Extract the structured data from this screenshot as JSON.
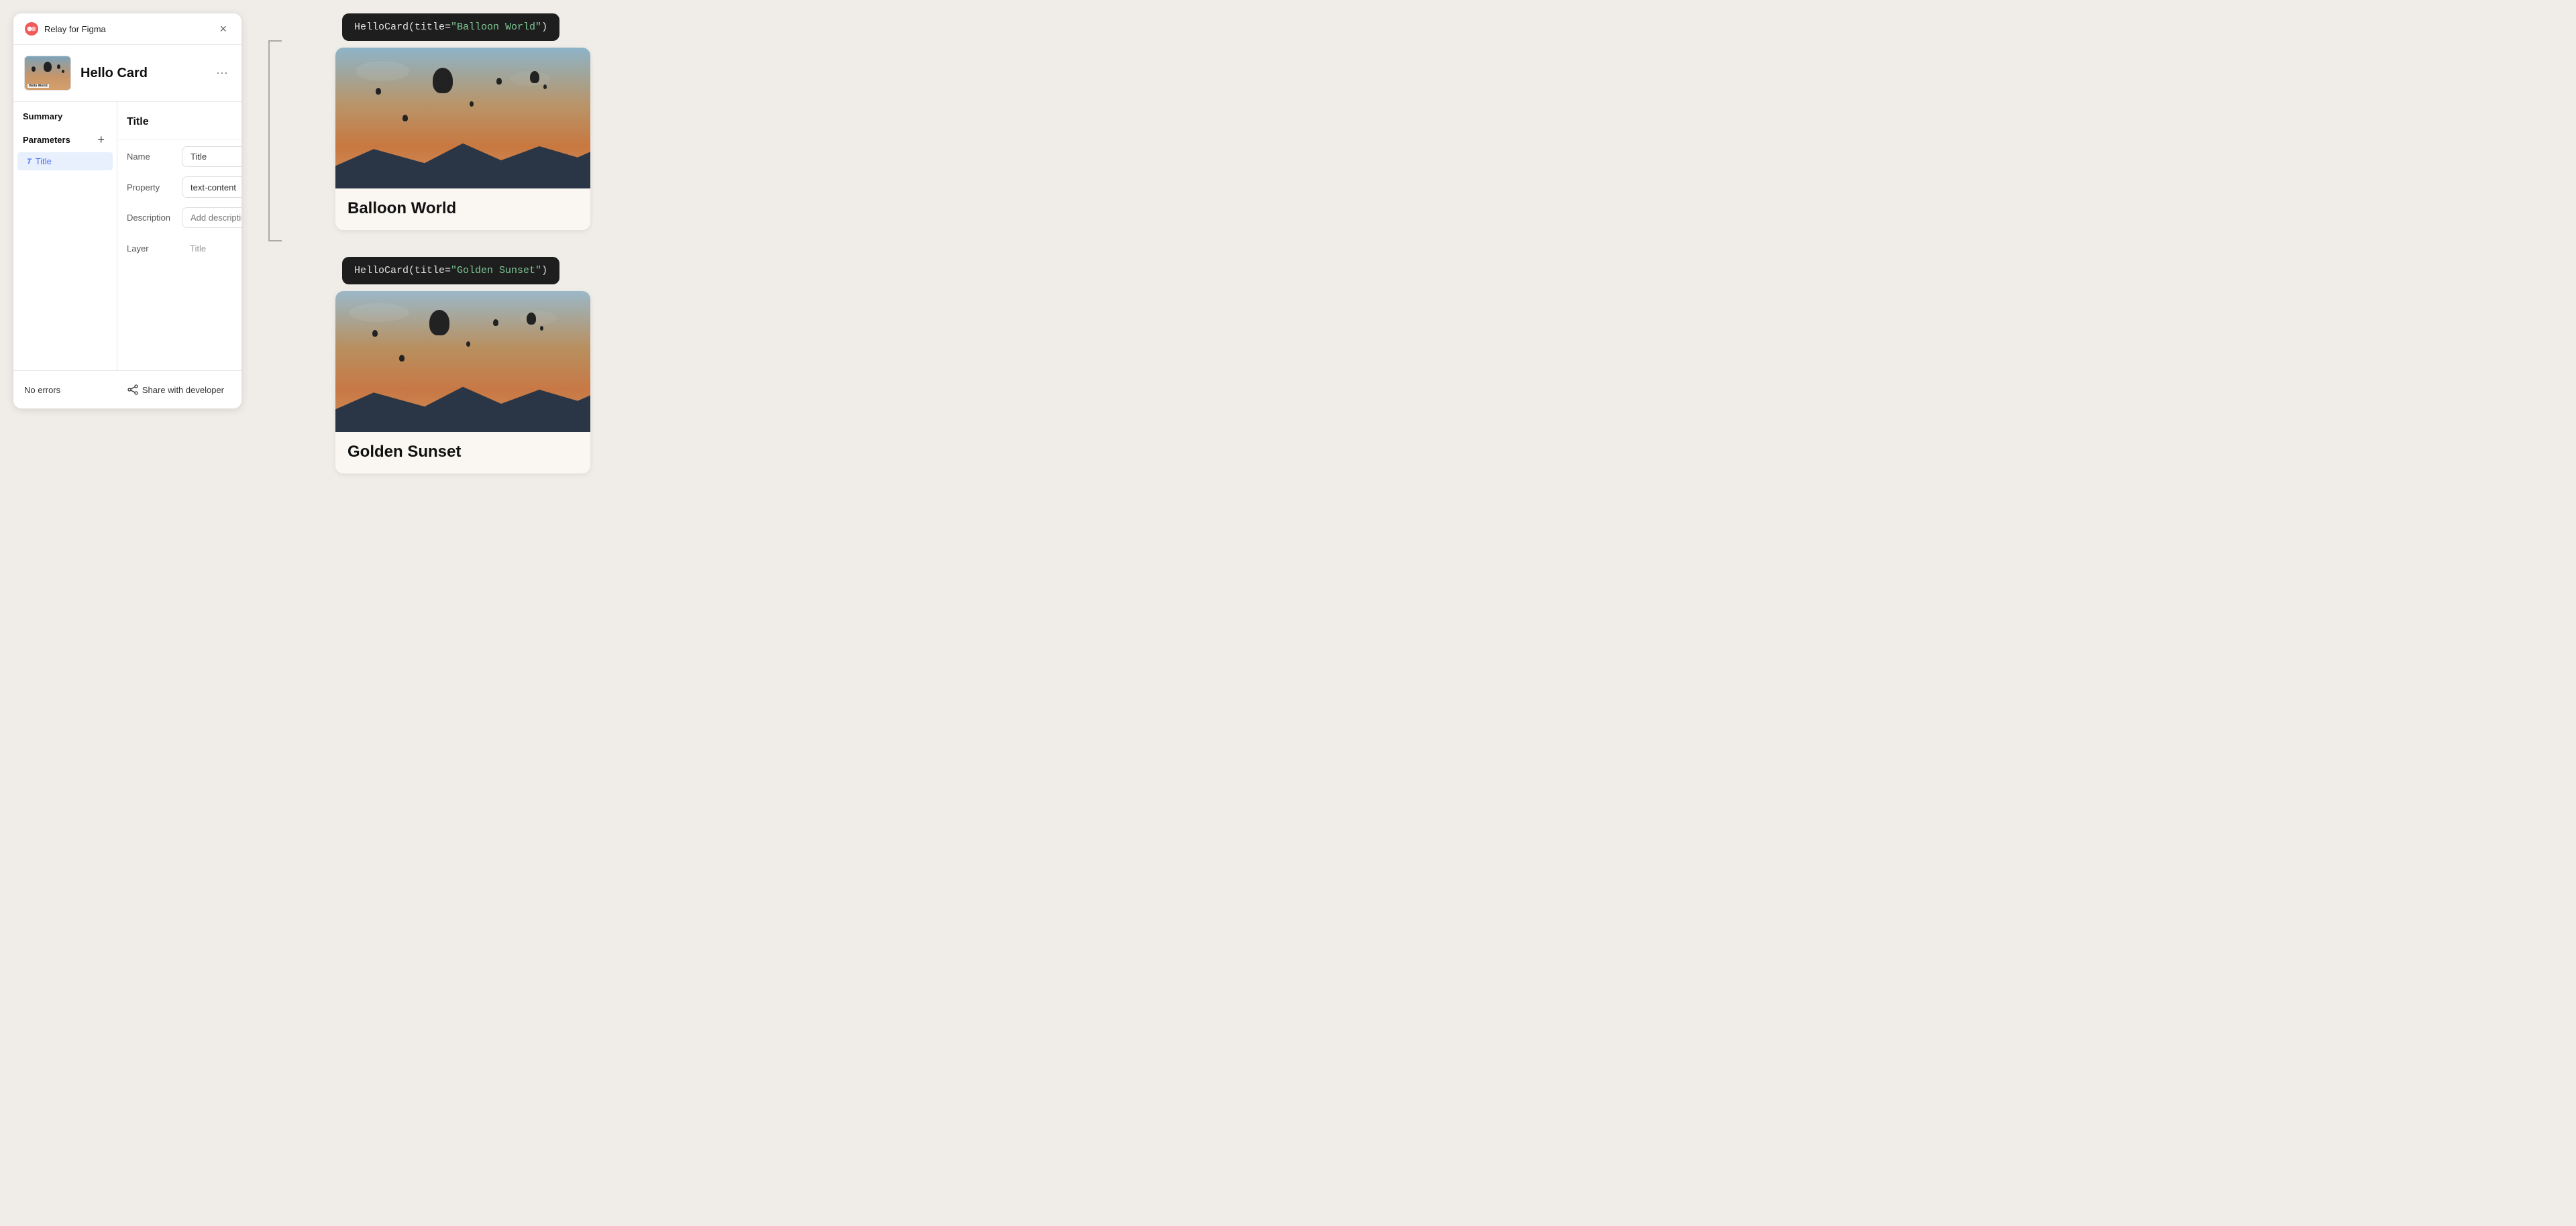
{
  "app": {
    "name": "Relay for Figma",
    "close_label": "×"
  },
  "component": {
    "name": "Hello Card",
    "thumbnail_text": "Hello World"
  },
  "tabs": {
    "summary_label": "Summary",
    "parameters_label": "Parameters"
  },
  "params": {
    "add_button_label": "+",
    "items": [
      {
        "type": "T",
        "name": "Title"
      }
    ]
  },
  "detail": {
    "title": "Title",
    "delete_label": "🗑",
    "fields": {
      "name_label": "Name",
      "name_value": "Title",
      "name_placeholder": "",
      "property_label": "Property",
      "property_value": "text-content",
      "description_label": "Description",
      "description_placeholder": "Add description",
      "layer_label": "Layer",
      "layer_value": "Title"
    }
  },
  "footer": {
    "no_errors_label": "No errors",
    "share_label": "Share with developer"
  },
  "cards": [
    {
      "tooltip": "HelloCard(title=\"Balloon World\")",
      "tooltip_fn": "HelloCard(title=",
      "tooltip_str": "\"Balloon World\"",
      "tooltip_close": ")",
      "title": "Balloon World"
    },
    {
      "tooltip": "HelloCard(title=\"Golden Sunset\")",
      "tooltip_fn": "HelloCard(title=",
      "tooltip_str": "\"Golden Sunset\"",
      "tooltip_close": ")",
      "title": "Golden Sunset"
    }
  ]
}
